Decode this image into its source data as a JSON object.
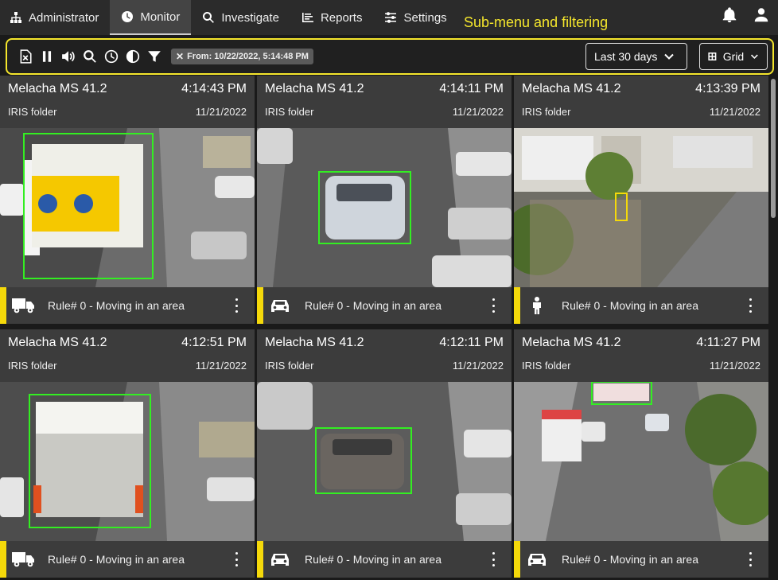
{
  "nav": {
    "items": [
      {
        "label": "Administrator",
        "icon": "sitemap-icon"
      },
      {
        "label": "Monitor",
        "icon": "clock-icon"
      },
      {
        "label": "Investigate",
        "icon": "search-icon"
      },
      {
        "label": "Reports",
        "icon": "reports-icon"
      },
      {
        "label": "Settings",
        "icon": "sliders-icon"
      }
    ],
    "active": "Monitor",
    "annotation": "Sub-menu and filtering"
  },
  "toolbar": {
    "filter_chip": "From: 10/22/2022, 5:14:48 PM",
    "range_label": "Last 30 days",
    "view_label": "Grid"
  },
  "cards": [
    {
      "camera": "Melacha MS 41.2",
      "time": "4:14:43 PM",
      "folder": "IRIS folder",
      "date": "11/21/2022",
      "rule": "Rule# 0 - Moving in an area",
      "object": "truck-icon"
    },
    {
      "camera": "Melacha MS 41.2",
      "time": "4:14:11 PM",
      "folder": "IRIS folder",
      "date": "11/21/2022",
      "rule": "Rule# 0 - Moving in an area",
      "object": "car-icon"
    },
    {
      "camera": "Melacha MS 41.2",
      "time": "4:13:39 PM",
      "folder": "IRIS folder",
      "date": "11/21/2022",
      "rule": "Rule# 0 - Moving in an area",
      "object": "person-icon"
    },
    {
      "camera": "Melacha MS 41.2",
      "time": "4:12:51 PM",
      "folder": "IRIS folder",
      "date": "11/21/2022",
      "rule": "Rule# 0 - Moving in an area",
      "object": "truck-icon"
    },
    {
      "camera": "Melacha MS 41.2",
      "time": "4:12:11 PM",
      "folder": "IRIS folder",
      "date": "11/21/2022",
      "rule": "Rule# 0 - Moving in an area",
      "object": "car-icon"
    },
    {
      "camera": "Melacha MS 41.2",
      "time": "4:11:27 PM",
      "folder": "IRIS folder",
      "date": "11/21/2022",
      "rule": "Rule# 0 - Moving in an area",
      "object": "car-icon"
    }
  ],
  "colors": {
    "accent": "#f5e62c",
    "detection_box": "#33ee22"
  }
}
